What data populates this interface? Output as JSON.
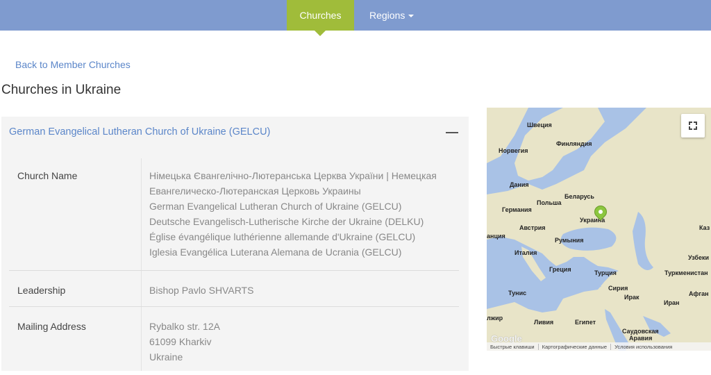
{
  "nav": {
    "churches": "Churches",
    "regions": "Regions"
  },
  "back_link": "Back to Member Churches",
  "page_title": "Churches in Ukraine",
  "panel": {
    "title": "German Evangelical Lutheran Church of Ukraine (GELCU)",
    "rows": {
      "church_name": {
        "label": "Church Name",
        "lines": [
          "Німецька Євангелічно-Лютеранська Церква України | Немецкая",
          "Евангелическо-Лютеранская Церковь Украины",
          "German Evangelical Lutheran Church of Ukraine (GELCU)",
          "Deutsche Evangelisch-Lutherische Kirche der Ukraine (DELKU)",
          "Église évangélique luthérienne allemande d'Ukraine (GELCU)",
          "Iglesia Evangélica Luterana Alemana de Ucrania (GELCU)"
        ]
      },
      "leadership": {
        "label": "Leadership",
        "value": "Bishop Pavlo SHVARTS"
      },
      "mailing_address": {
        "label": "Mailing Address",
        "lines": [
          "Rybalko str. 12A",
          "61099 Kharkiv",
          "Ukraine"
        ]
      }
    }
  },
  "map": {
    "labels": {
      "sweden": "Швеция",
      "finland": "Финляндия",
      "norway": "Норвегия",
      "denmark": "Дания",
      "belarus": "Беларусь",
      "poland": "Польша",
      "germany": "Германия",
      "ukraine": "Украина",
      "austria": "Австрия",
      "kaz": "Каз",
      "france": "анция",
      "romania": "Румыния",
      "italy": "Италия",
      "uzbek": "Узбеки",
      "greece": "Греция",
      "turkey": "Турция",
      "turkmen": "Туркменистан",
      "syria": "Сирия",
      "tunisia": "Тунис",
      "iraq": "Ирак",
      "iran": "Иран",
      "afghan": "Афган",
      "algeria": "лжир",
      "libya": "Ливия",
      "egypt": "Египет",
      "saudi": "Саудовская",
      "arabia": "Аравия"
    },
    "google": "Google",
    "footer": {
      "shortcuts": "Быстрые клавиши",
      "map_data": "Картографические данные",
      "terms": "Условия использования"
    },
    "colors": {
      "water": "#a9c2e6",
      "land": "#e8e4c8",
      "pin": "#8cc63f"
    }
  }
}
